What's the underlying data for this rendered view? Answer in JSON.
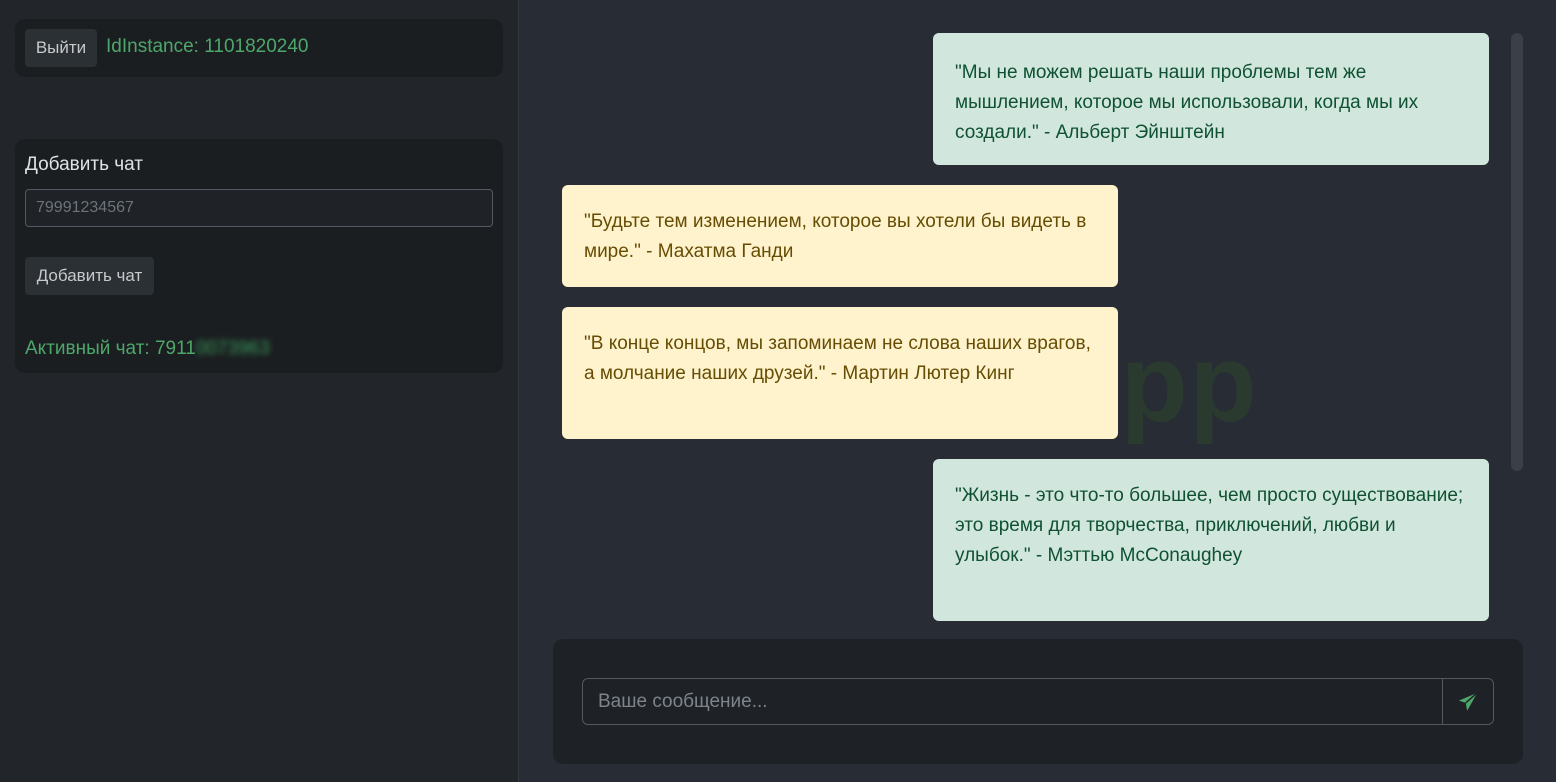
{
  "sidebar": {
    "logout_label": "Выйти",
    "instance_label": "IdInstance: 1101820240",
    "add_chat": {
      "title": "Добавить чат",
      "phone_placeholder": "79991234567",
      "button_label": "Добавить чат"
    },
    "active_chat": {
      "label": "Активный чат: 7911",
      "blurred_number": "0073963"
    }
  },
  "watermark": "App",
  "messages": [
    {
      "direction": "out",
      "text": "\"Мы не можем решать наши проблемы тем же мышлением, которое мы использовали, когда мы их создали.\" - Альберт Эйнштейн"
    },
    {
      "direction": "in",
      "text": "\"Будьте тем изменением, которое вы хотели бы видеть в мире.\" - Махатма Ганди"
    },
    {
      "direction": "in",
      "text": "\"В конце концов, мы запоминаем не слова наших врагов, а молчание наших друзей.\" - Мартин Лютер Кинг"
    },
    {
      "direction": "out",
      "text": "\"Жизнь - это что-то большее, чем просто существование; это время для творчества, приключений, любви и улыбок.\" - Мэттью McConaughey"
    }
  ],
  "composer": {
    "placeholder": "Ваше сообщение...",
    "send_icon": "send-icon"
  },
  "colors": {
    "accent_green": "#4ea76a",
    "outgoing_bg": "#d1e7dd",
    "incoming_bg": "#fff3cd"
  }
}
